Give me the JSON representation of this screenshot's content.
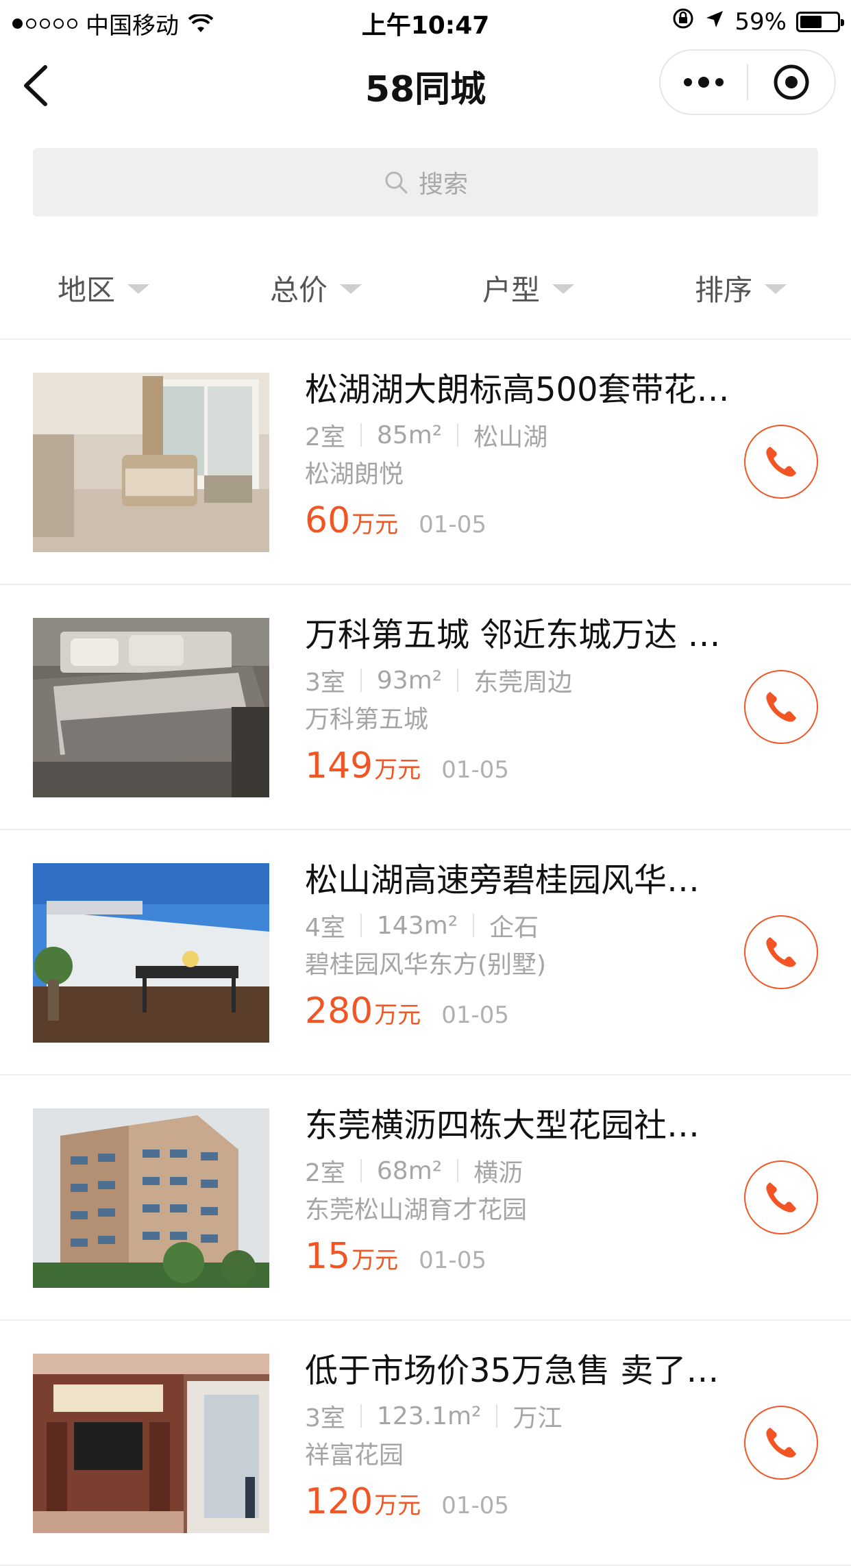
{
  "status_bar": {
    "carrier": "中国移动",
    "time": "上午10:47",
    "battery_percent": "59%",
    "battery_level": 0.59
  },
  "nav": {
    "title": "58同城"
  },
  "search": {
    "placeholder": "搜索"
  },
  "filters": [
    "地区",
    "总价",
    "户型",
    "排序"
  ],
  "listings": [
    {
      "title": "松湖湖大朗标高500套带花…",
      "rooms": "2室",
      "area": "85",
      "area_unit": "m²",
      "district": "松山湖",
      "community": "松湖朗悦",
      "price": "60",
      "price_unit": "万元",
      "date": "01-05"
    },
    {
      "title": "万科第五城 邻近东城万达 …",
      "rooms": "3室",
      "area": "93",
      "area_unit": "m²",
      "district": "东莞周边",
      "community": "万科第五城",
      "price": "149",
      "price_unit": "万元",
      "date": "01-05"
    },
    {
      "title": "松山湖高速旁碧桂园风华…",
      "rooms": "4室",
      "area": "143",
      "area_unit": "m²",
      "district": "企石",
      "community": "碧桂园风华东方(别墅)",
      "price": "280",
      "price_unit": "万元",
      "date": "01-05"
    },
    {
      "title": "东莞横沥四栋大型花园社…",
      "rooms": "2室",
      "area": "68",
      "area_unit": "m²",
      "district": "横沥",
      "community": "东莞松山湖育才花园",
      "price": "15",
      "price_unit": "万元",
      "date": "01-05"
    },
    {
      "title": "低于市场价35万急售 卖了…",
      "rooms": "3室",
      "area": "123.1",
      "area_unit": "m²",
      "district": "万江",
      "community": "祥富花园",
      "price": "120",
      "price_unit": "万元",
      "date": "01-05"
    }
  ],
  "colors": {
    "accent": "#f25424",
    "muted_text": "#a5a5a5",
    "search_bg": "#efefef"
  }
}
